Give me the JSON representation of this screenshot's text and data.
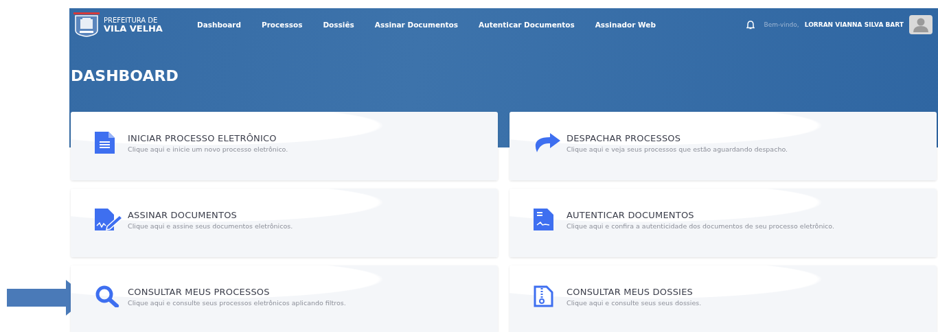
{
  "brand": {
    "line1": "PREFEITURA DE",
    "line2": "VILA VELHA"
  },
  "nav": [
    {
      "label": "Dashboard"
    },
    {
      "label": "Processos"
    },
    {
      "label": "Dossiês"
    },
    {
      "label": "Assinar Documentos"
    },
    {
      "label": "Autenticar Documentos"
    },
    {
      "label": "Assinador Web"
    }
  ],
  "user": {
    "greeting": "Bem-vindo,",
    "name": "LORRAN VIANNA SILVA BART"
  },
  "page_title": "DASHBOARD",
  "cards": [
    {
      "title": "INICIAR PROCESSO ELETRÔNICO",
      "description": "Clique aqui e inicie um novo processo eletrônico."
    },
    {
      "title": "DESPACHAR PROCESSOS",
      "description": "Clique aqui e veja seus processos que estão aguardando despacho."
    },
    {
      "title": "ASSINAR DOCUMENTOS",
      "description": "Clique aqui e assine seus documentos eletrônicos."
    },
    {
      "title": "AUTENTICAR DOCUMENTOS",
      "description": "Clique aqui e confira a autenticidade dos documentos de seu processo eletrônico."
    },
    {
      "title": "CONSULTAR MEUS PROCESSOS",
      "description": "Clique aqui e consulte seus processos eletrônicos aplicando filtros."
    },
    {
      "title": "CONSULTAR MEUS DOSSIES",
      "description": "Clique aqui e consulte seus seus dossies."
    }
  ]
}
